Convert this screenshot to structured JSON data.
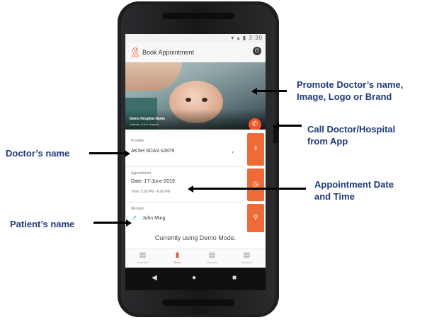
{
  "app": {
    "title": "Book Appointment",
    "status_icons": "▾ ▴ ▮ 3:30"
  },
  "banner": {
    "hospital_name": "Demo Hospital Name",
    "hospital_address": "Address of the hospital"
  },
  "provider": {
    "label": "Provider",
    "value": "AKSH SDAS s2879"
  },
  "appointment": {
    "label": "Appointment",
    "date": "Date: 17-June-2019",
    "time": "Time: 5:30 PM - 6:00 PM"
  },
  "member": {
    "label": "Member",
    "name": "John Ming"
  },
  "mode_text": "Currently using Demo Mode.",
  "bottom_nav": [
    {
      "icon": "▤",
      "label": "Hospitals"
    },
    {
      "icon": "▮",
      "label": "Book"
    },
    {
      "icon": "▤",
      "label": "Records"
    },
    {
      "icon": "▤",
      "label": "Account"
    }
  ],
  "system_nav": {
    "back": "◀",
    "home": "●",
    "recent": "■"
  },
  "annotations": {
    "promote": [
      "Promote Doctor’s  name,",
      "Image, Logo or Brand"
    ],
    "call": [
      "Call Doctor/Hospital",
      "from App"
    ],
    "doctor": "Doctor’s name",
    "appointment": [
      "Appointment Date",
      "and Time"
    ],
    "patient": "Patient’s name"
  },
  "colors": {
    "accent": "#e8562a",
    "annotation_text": "#1f3a7a"
  }
}
